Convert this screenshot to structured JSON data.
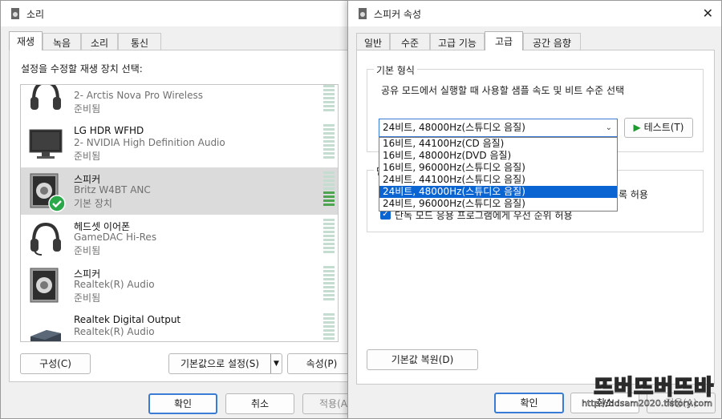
{
  "sound_window": {
    "title": "소리",
    "tabs": [
      "재생",
      "녹음",
      "소리",
      "통신"
    ],
    "instruction": "설정을 수정할 재생 장치 선택:",
    "devices": [
      {
        "name": "",
        "desc": "2- Arctis Nova Pro Wireless",
        "status": "준비됨",
        "icon": "headset-icon"
      },
      {
        "name": "LG HDR WFHD",
        "desc": "2- NVIDIA High Definition Audio",
        "status": "준비됨",
        "icon": "monitor-icon"
      },
      {
        "name": "스피커",
        "desc": "Britz W4BT ANC",
        "status": "기본 장치",
        "icon": "speaker-icon"
      },
      {
        "name": "헤드셋 이어폰",
        "desc": "GameDAC Hi-Res",
        "status": "준비됨",
        "icon": "headset-icon"
      },
      {
        "name": "스피커",
        "desc": "Realtek(R) Audio",
        "status": "준비됨",
        "icon": "speaker-icon"
      },
      {
        "name": "Realtek Digital Output",
        "desc": "Realtek(R) Audio",
        "status": "",
        "icon": "digital-output-icon"
      }
    ],
    "configure_label": "구성(C)",
    "set_default_label": "기본값으로 설정(S)",
    "properties_label": "속성(P)",
    "ok_label": "확인",
    "cancel_label": "취소",
    "apply_label": "적용(A"
  },
  "props_window": {
    "title": "스피커 속성",
    "tabs": [
      "일반",
      "수준",
      "고급 기능",
      "고급",
      "공간 음향"
    ],
    "default_format_title": "기본 형식",
    "default_format_desc": "공유 모드에서 실행할 때 사용할 샘플 속도 및 비트 수준 선택",
    "selected_format": "24비트, 48000Hz(스튜디오 음질)",
    "test_label": "테스트(T)",
    "format_options": [
      "16비트, 44100Hz(CD 음질)",
      "16비트, 48000Hz(DVD 음질)",
      "16비트, 96000Hz(스튜디오 음질)",
      "24비트, 44100Hz(스튜디오 음질)",
      "24비트, 48000Hz(스튜디오 음질)",
      "24비트, 96000Hz(스튜디오 음질)"
    ],
    "selected_option_index": 4,
    "exclusive_title_partial": "단",
    "exclusive_opt1_tail": "록 허용",
    "exclusive_opt2": "단독 모드 응용 프로그램에게 우선 순위 허용",
    "restore_defaults_label": "기본값 복원(D)",
    "ok_label": "확인",
    "cancel_label": "취소",
    "apply_label": "적용(A)"
  },
  "watermark": {
    "big": "뜨버뜨버뜨바",
    "small": "http://ddsam2020.tistory.com"
  },
  "colors": {
    "accent": "#0a64d2",
    "meter_active": "#4da64f",
    "meter_idle": "#c4ddd0",
    "check_green": "#2aa84a"
  }
}
